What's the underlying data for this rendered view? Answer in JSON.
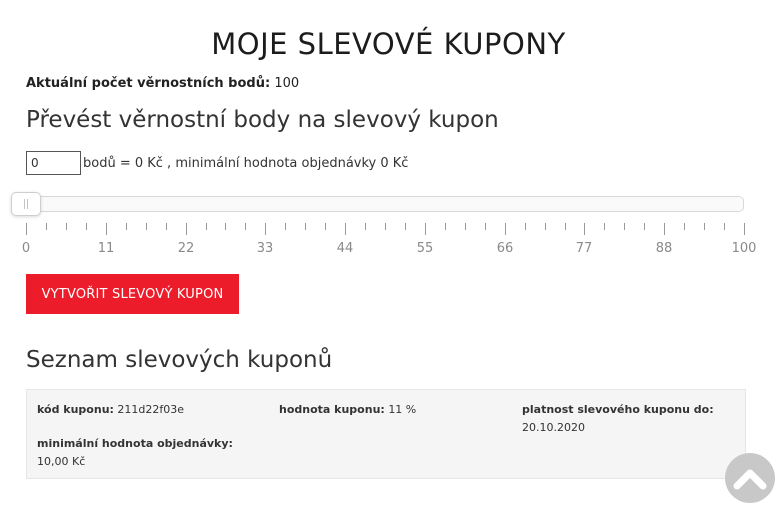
{
  "page": {
    "title": "MOJE SLEVOVÉ KUPONY"
  },
  "loyalty": {
    "points_label": "Aktuální počet věrnostních bodů:",
    "points_value": "100"
  },
  "convert": {
    "heading": "Převést věrnostní body na slevový kupon",
    "input_value": "0",
    "description": "bodů = 0 Kč , minimální hodnota objednávky 0 Kč"
  },
  "slider": {
    "min": 0,
    "max": 100,
    "value": 0,
    "tick_labels": [
      "0",
      "11",
      "22",
      "33",
      "44",
      "55",
      "66",
      "77",
      "88",
      "100"
    ],
    "minor_ticks_between": 3
  },
  "create_button": {
    "label": "VYTVOŘIT SLEVOVÝ KUPON",
    "color": "#ed1c2a"
  },
  "coupons": {
    "heading": "Seznam slevových kuponů",
    "items": [
      {
        "code_label": "kód kuponu:",
        "code": "211d22f03e",
        "value_label": "hodnota kuponu:",
        "value": "11 %",
        "validity_label": "platnost slevového kuponu do:",
        "validity": "20.10.2020",
        "min_order_label": "minimální hodnota objednávky:",
        "min_order": "10,00 Kč"
      }
    ]
  },
  "scroll_top": {
    "icon": "chevron-up-icon"
  }
}
